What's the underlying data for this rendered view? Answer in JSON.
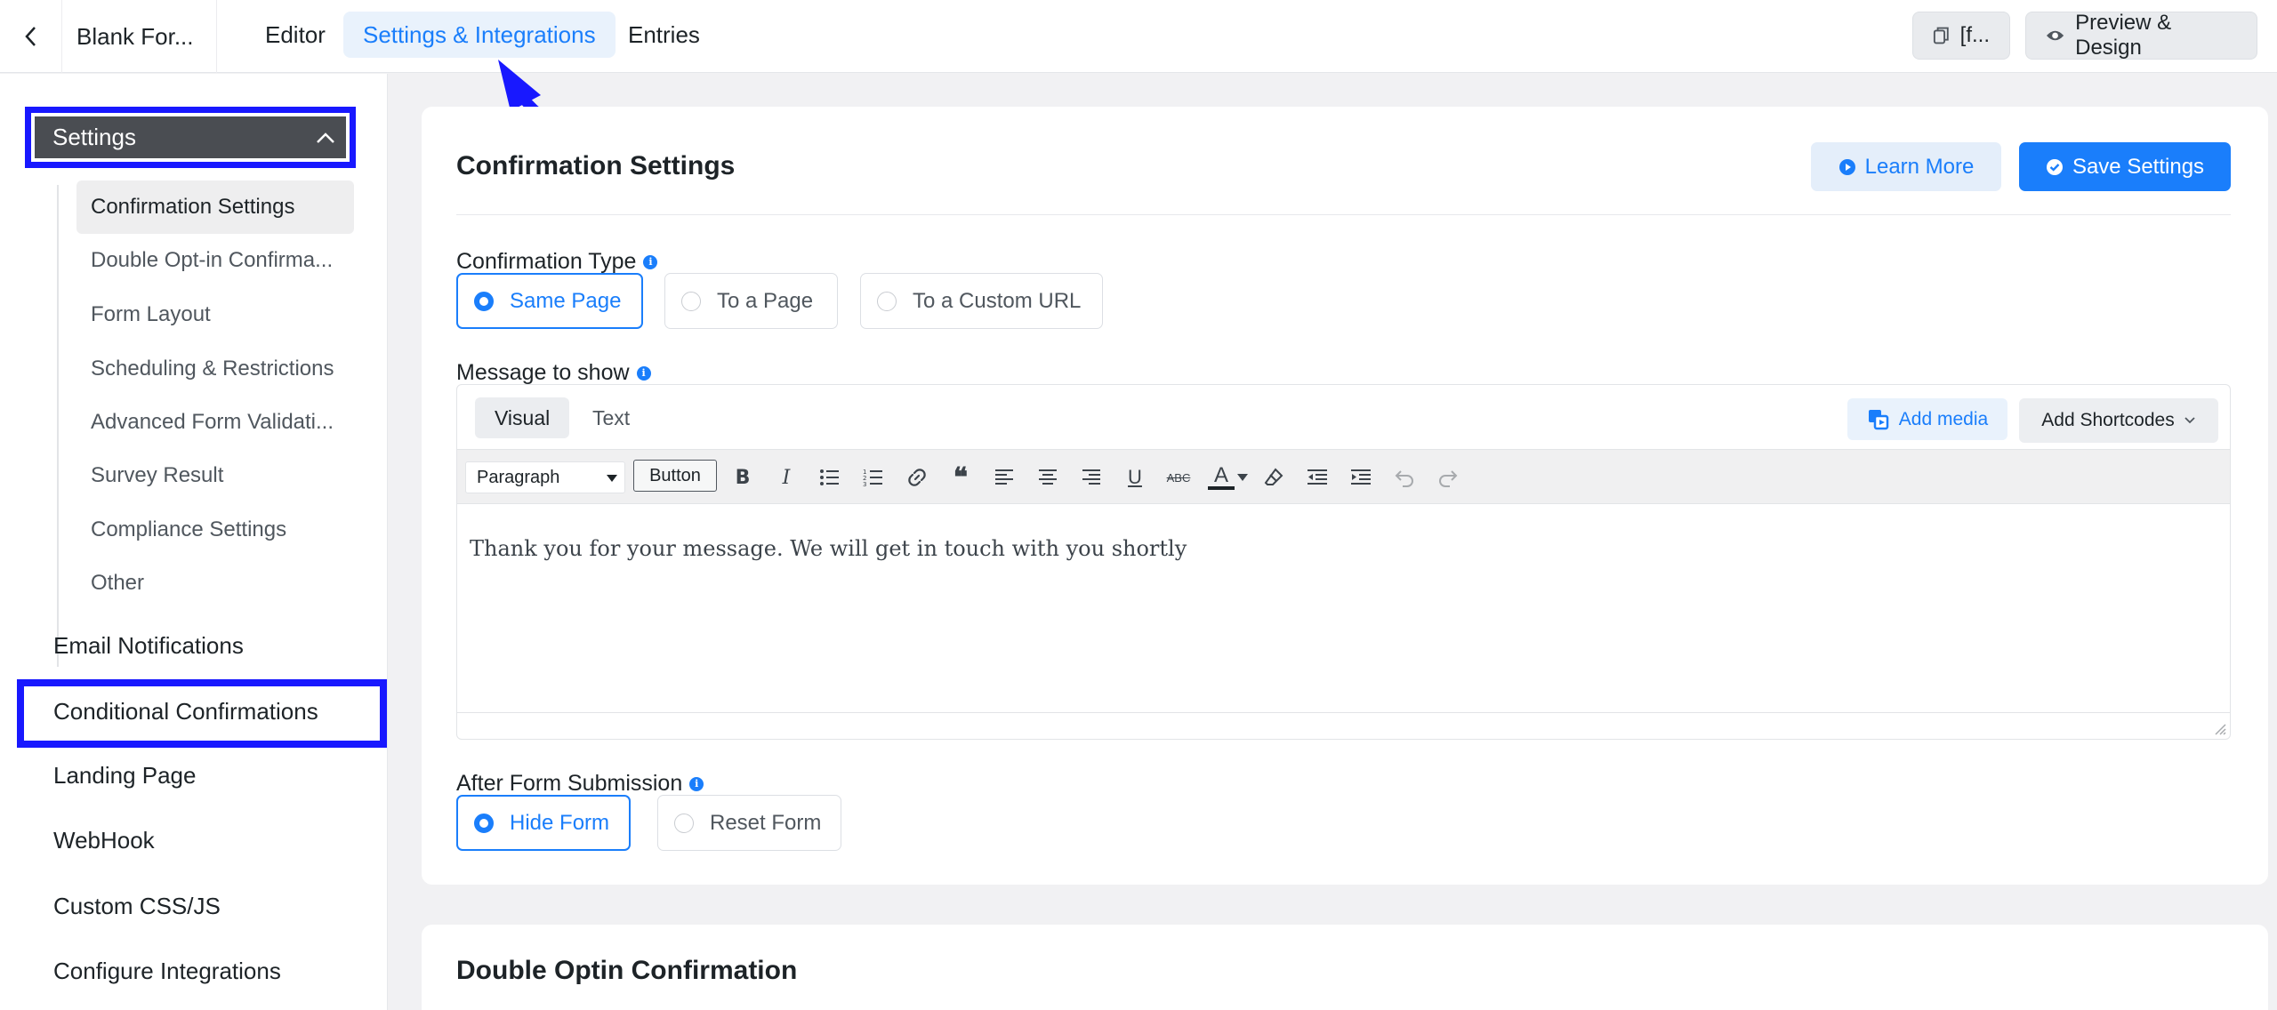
{
  "topbar": {
    "form_title": "Blank For...",
    "tabs": [
      {
        "label": "Editor"
      },
      {
        "label": "Settings & Integrations"
      },
      {
        "label": "Entries"
      }
    ],
    "shortcode_label": "[f...",
    "preview_label": "Preview & Design"
  },
  "sidebar": {
    "settings_label": "Settings",
    "sub_items": [
      {
        "label": "Confirmation Settings"
      },
      {
        "label": "Double Opt-in Confirma..."
      },
      {
        "label": "Form Layout"
      },
      {
        "label": "Scheduling & Restrictions"
      },
      {
        "label": "Advanced Form Validati..."
      },
      {
        "label": "Survey Result"
      },
      {
        "label": "Compliance Settings"
      },
      {
        "label": "Other"
      }
    ],
    "main_items": [
      {
        "label": "Email Notifications"
      },
      {
        "label": "Conditional Confirmations"
      },
      {
        "label": "Landing Page"
      },
      {
        "label": "WebHook"
      },
      {
        "label": "Custom CSS/JS"
      },
      {
        "label": "Configure Integrations"
      }
    ]
  },
  "confirmation": {
    "title": "Confirmation Settings",
    "learn_more": "Learn More",
    "save": "Save Settings",
    "type_label": "Confirmation Type",
    "type_options": [
      "Same Page",
      "To a Page",
      "To a Custom URL"
    ],
    "message_label": "Message to show",
    "editor": {
      "tab_visual": "Visual",
      "tab_text": "Text",
      "add_media": "Add media",
      "add_shortcodes": "Add Shortcodes",
      "format_select": "Paragraph",
      "button_tool": "Button",
      "content": "Thank you for your message. We will get in touch with you shortly"
    },
    "after_label": "After Form Submission",
    "after_options": [
      "Hide Form",
      "Reset Form"
    ]
  },
  "double_optin": {
    "title": "Double Optin Confirmation"
  },
  "colors": {
    "accent": "#1a7efb",
    "annotation": "#1818ff"
  }
}
